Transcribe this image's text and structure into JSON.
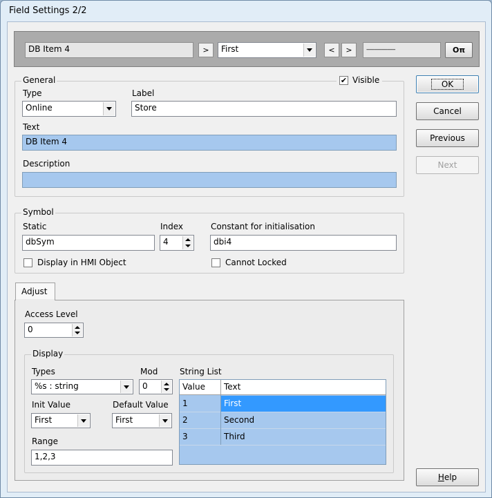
{
  "window": {
    "title": "Field Settings 2/2"
  },
  "navbar": {
    "item_value": "DB Item 4",
    "next_arrow": ">",
    "select_value": "First",
    "prev_arrow": "<",
    "next_arrow2": ">",
    "dotted_value": "----------------------",
    "key_icon_glyph": "Oπ"
  },
  "general": {
    "legend": "General",
    "visible_label": "Visible",
    "visible_checked": "✔",
    "type_label": "Type",
    "type_value": "Online",
    "label_label": "Label",
    "label_value": "Store",
    "text_label": "Text",
    "text_value": "DB Item 4",
    "description_label": "Description",
    "description_value": ""
  },
  "symbol": {
    "legend": "Symbol",
    "static_label": "Static",
    "static_value": "dbSym",
    "index_label": "Index",
    "index_value": "4",
    "constant_label": "Constant for initialisation",
    "constant_value": "dbi4",
    "display_hmi_label": "Display in HMI Object",
    "cannot_locked_label": "Cannot Locked"
  },
  "adjust": {
    "tab_label": "Adjust",
    "access_level_label": "Access Level",
    "access_level_value": "0"
  },
  "display": {
    "legend": "Display",
    "types_label": "Types",
    "types_value": "%s : string",
    "mod_label": "Mod",
    "mod_value": "0",
    "init_value_label": "Init Value",
    "init_value": "First",
    "default_value_label": "Default Value",
    "default_value": "First",
    "range_label": "Range",
    "range_value": "1,2,3",
    "string_list_label": "String List",
    "string_list": {
      "headers": [
        "Value",
        "Text"
      ],
      "rows": [
        {
          "value": "1",
          "text": "First"
        },
        {
          "value": "2",
          "text": "Second"
        },
        {
          "value": "3",
          "text": "Third"
        }
      ]
    }
  },
  "buttons": {
    "ok": "OK",
    "cancel": "Cancel",
    "previous": "Previous",
    "next": "Next",
    "help_underlined": "H",
    "help_rest": "elp"
  }
}
